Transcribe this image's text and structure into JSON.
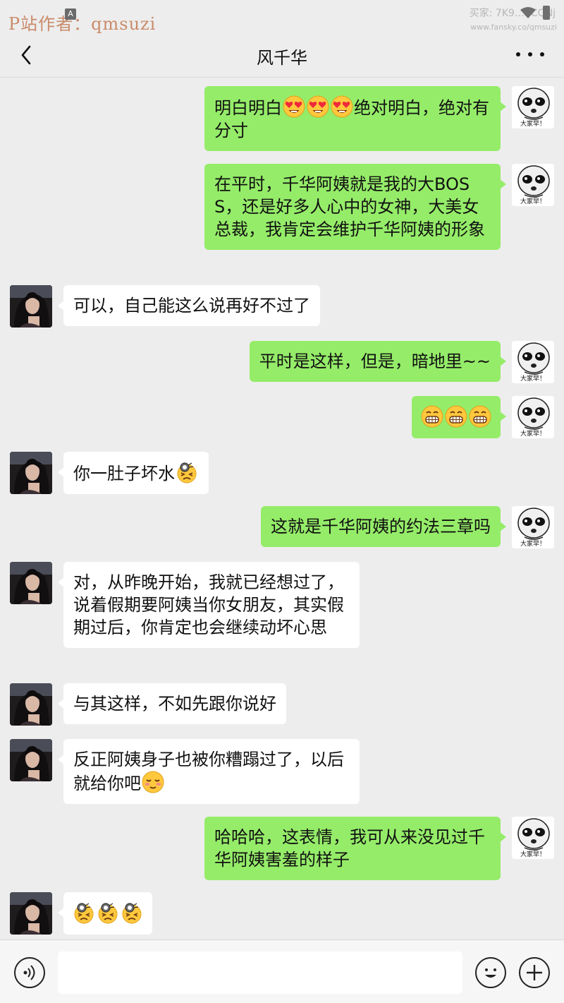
{
  "watermark": {
    "left": "P站作者：qmsuzi",
    "right_line1": "买家: 7K9…2CQNj",
    "right_line2": "www.fansky.co/qmsuzi"
  },
  "status_bar": {
    "a_badge": "A"
  },
  "header": {
    "title": "风千华"
  },
  "me_avatar_caption": "大家早！",
  "messages": [
    {
      "from": "me",
      "text": "明白明白",
      "emojis_after": [
        "heart-eyes-emoji",
        "heart-eyes-emoji",
        "heart-eyes-emoji"
      ],
      "text_after": "绝对明白，绝对有分寸"
    },
    {
      "from": "me",
      "text": "在平时，千华阿姨就是我的大BOSS，还是好多人心中的女神，大美女总裁，我肯定会维护千华阿姨的形象"
    },
    {
      "from": "other",
      "text": "可以，自己能这么说再好不过了"
    },
    {
      "from": "me",
      "text": "平时是这样，但是，暗地里~~"
    },
    {
      "from": "me",
      "emojis": [
        "grin-emoji",
        "grin-emoji",
        "grin-emoji"
      ]
    },
    {
      "from": "other",
      "text": "你一肚子坏水",
      "emojis_after": [
        "shocked-eyes-emoji"
      ]
    },
    {
      "from": "me",
      "text": "这就是千华阿姨的约法三章吗"
    },
    {
      "from": "other",
      "text": "对，从昨晚开始，我就已经想过了，说着假期要阿姨当你女朋友，其实假期过后，你肯定也会继续动坏心思"
    },
    {
      "from": "other",
      "text": "与其这样，不如先跟你说好"
    },
    {
      "from": "other",
      "text": "反正阿姨身子也被你糟蹋过了，以后就给你吧",
      "emojis_after": [
        "blush-emoji"
      ]
    },
    {
      "from": "me",
      "text": "哈哈哈，这表情，我可从来没见过千华阿姨害羞的样子"
    },
    {
      "from": "other",
      "emojis": [
        "shocked-eyes-emoji",
        "shocked-eyes-emoji",
        "shocked-eyes-emoji"
      ]
    }
  ],
  "input_bar": {
    "placeholder": ""
  },
  "colors": {
    "me_bubble": "#95ec69",
    "other_bubble": "#ffffff",
    "background": "#ededed"
  }
}
